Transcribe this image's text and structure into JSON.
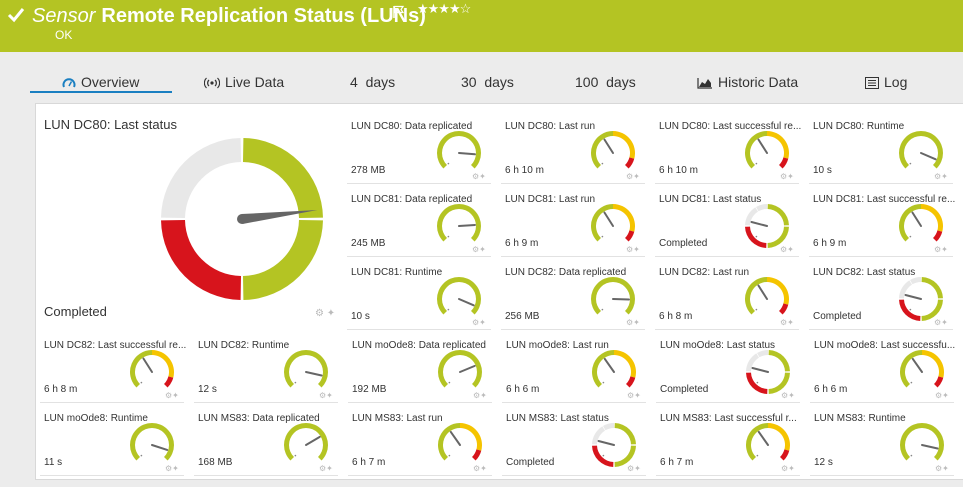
{
  "header": {
    "sensor_label": "Sensor",
    "title": "Remote Replication Status (LUNs)",
    "stars": "★★★★☆",
    "status": "OK"
  },
  "tabs": [
    {
      "label": "Overview",
      "icon": "gauge-icon",
      "active": true
    },
    {
      "label": "Live Data",
      "icon": "broadcast-icon"
    },
    {
      "label": "4  days"
    },
    {
      "label": "30  days"
    },
    {
      "label": "100  days"
    },
    {
      "label": "Historic Data",
      "icon": "area-chart-icon"
    },
    {
      "label": "Log",
      "icon": "log-list-icon"
    }
  ],
  "main_gauge": {
    "title": "LUN DC80: Last status",
    "value": "Completed",
    "level": 0.22
  },
  "colors": {
    "green": "#b4c423",
    "yellow": "#f5c400",
    "red": "#d7141c",
    "grey": "#e8e8e8"
  },
  "tiles": [
    {
      "title": "LUN DC80: Data replicated",
      "value": "278 MB",
      "kind": "green",
      "level": 0.85
    },
    {
      "title": "LUN DC80: Last run",
      "value": "6 h 10 m",
      "kind": "warn",
      "level": 0.38
    },
    {
      "title": "LUN DC80: Last successful re...",
      "value": "6 h 10 m",
      "kind": "warn",
      "level": 0.38
    },
    {
      "title": "LUN DC80: Runtime",
      "value": "10 s",
      "kind": "green",
      "level": 0.92
    },
    {
      "title": "LUN DC81: Data replicated",
      "value": "245 MB",
      "kind": "green",
      "level": 0.82
    },
    {
      "title": "LUN DC81: Last run",
      "value": "6 h 9 m",
      "kind": "warn",
      "level": 0.38
    },
    {
      "title": "LUN DC81: Last status",
      "value": "Completed",
      "kind": "status",
      "level": 0.22
    },
    {
      "title": "LUN DC81: Last successful re...",
      "value": "6 h 9 m",
      "kind": "warn",
      "level": 0.38
    },
    {
      "title": "LUN DC81: Runtime",
      "value": "10 s",
      "kind": "green",
      "level": 0.92
    },
    {
      "title": "LUN DC82: Data replicated",
      "value": "256 MB",
      "kind": "green",
      "level": 0.84
    },
    {
      "title": "LUN DC82: Last run",
      "value": "6 h 8 m",
      "kind": "warn",
      "level": 0.38
    },
    {
      "title": "LUN DC82: Last status",
      "value": "Completed",
      "kind": "status",
      "level": 0.22
    },
    {
      "title": "LUN DC82: Last successful re...",
      "value": "6 h 8 m",
      "kind": "warn",
      "level": 0.38
    },
    {
      "title": "LUN DC82: Runtime",
      "value": "12 s",
      "kind": "green",
      "level": 0.88
    },
    {
      "title": "LUN moOde8: Data replicated",
      "value": "192 MB",
      "kind": "green",
      "level": 0.75
    },
    {
      "title": "LUN moOde8: Last run",
      "value": "6 h 6 m",
      "kind": "warn",
      "level": 0.37
    },
    {
      "title": "LUN moOde8: Last status",
      "value": "Completed",
      "kind": "status",
      "level": 0.22
    },
    {
      "title": "LUN moOde8: Last successfu...",
      "value": "6 h 6 m",
      "kind": "warn",
      "level": 0.37
    },
    {
      "title": "LUN moOde8: Runtime",
      "value": "11 s",
      "kind": "green",
      "level": 0.9
    },
    {
      "title": "LUN MS83: Data replicated",
      "value": "168 MB",
      "kind": "green",
      "level": 0.72
    },
    {
      "title": "LUN MS83: Last run",
      "value": "6 h 7 m",
      "kind": "warn",
      "level": 0.37
    },
    {
      "title": "LUN MS83: Last status",
      "value": "Completed",
      "kind": "status",
      "level": 0.22
    },
    {
      "title": "LUN MS83: Last successful r...",
      "value": "6 h 7 m",
      "kind": "warn",
      "level": 0.37
    },
    {
      "title": "LUN MS83: Runtime",
      "value": "12 s",
      "kind": "green",
      "level": 0.88
    }
  ]
}
